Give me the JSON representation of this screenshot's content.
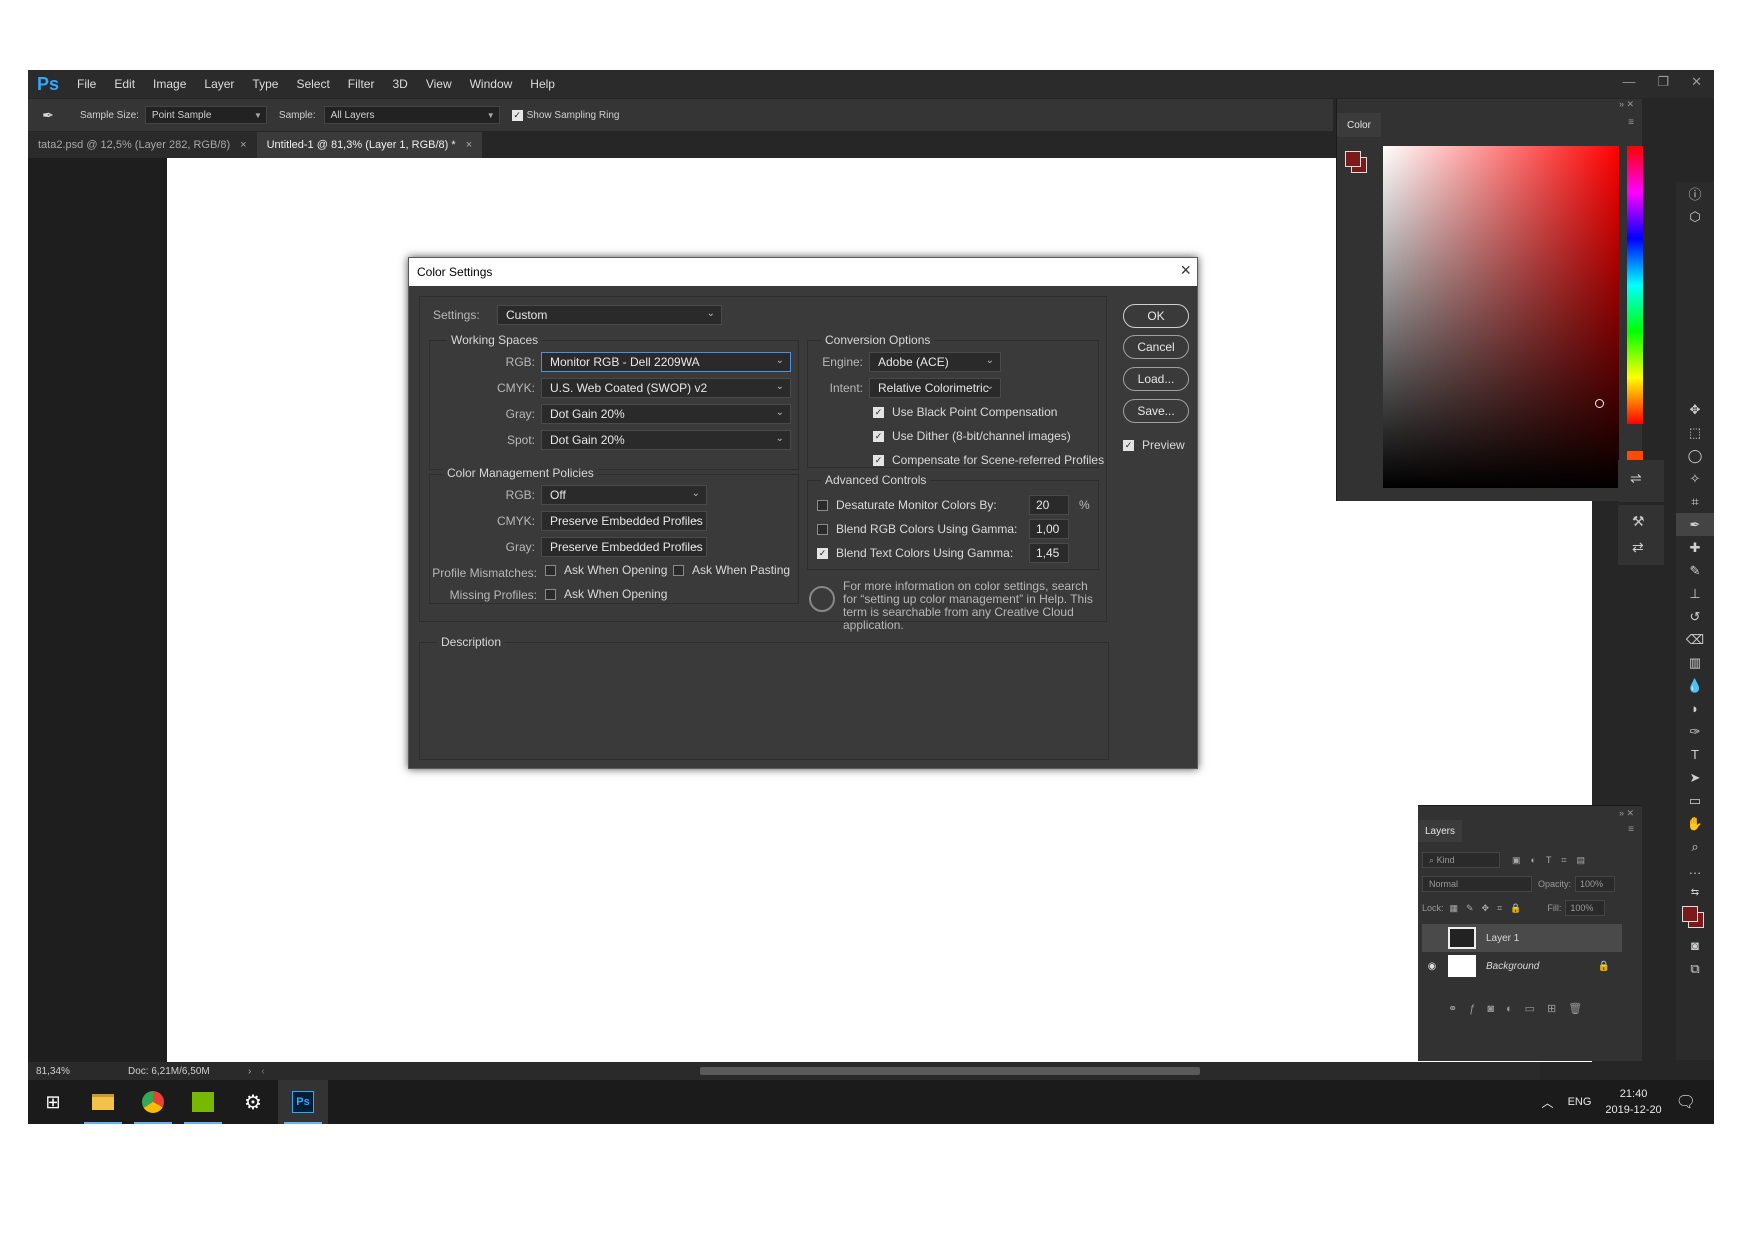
{
  "app": {
    "logo": "Ps",
    "menu": [
      "File",
      "Edit",
      "Image",
      "Layer",
      "Type",
      "Select",
      "Filter",
      "3D",
      "View",
      "Window",
      "Help"
    ],
    "window_controls": [
      "—",
      "❐",
      "✕"
    ]
  },
  "options_bar": {
    "sample_size_label": "Sample Size:",
    "sample_size_value": "Point Sample",
    "sample_label": "Sample:",
    "sample_value": "All Layers",
    "show_sampling_ring_label": "Show Sampling Ring",
    "show_sampling_ring_checked": true
  },
  "tabs": [
    {
      "label": "tata2.psd @ 12,5% (Layer 282, RGB/8)",
      "active": false
    },
    {
      "label": "Untitled-1 @ 81,3% (Layer 1, RGB/8) *",
      "active": true
    }
  ],
  "status_bar": {
    "zoom": "81,34%",
    "doc": "Doc: 6,21M/6,50M"
  },
  "color_panel": {
    "tab": "Color",
    "foreground": "#7a1a1a"
  },
  "layers_panel": {
    "tab": "Layers",
    "filter_placeholder": "Kind",
    "blend_mode": "Normal",
    "opacity_label": "Opacity:",
    "opacity_value": "100%",
    "lock_label": "Lock:",
    "fill_label": "Fill:",
    "fill_value": "100%",
    "layers": [
      {
        "name": "Layer 1",
        "visible": false,
        "selected": true
      },
      {
        "name": "Background",
        "visible": true,
        "locked": true
      }
    ]
  },
  "dialog": {
    "title": "Color Settings",
    "settings_label": "Settings:",
    "settings_value": "Custom",
    "working_spaces": {
      "title": "Working Spaces",
      "rgb_label": "RGB:",
      "rgb_value": "Monitor RGB - Dell 2209WA",
      "cmyk_label": "CMYK:",
      "cmyk_value": "U.S. Web Coated (SWOP) v2",
      "gray_label": "Gray:",
      "gray_value": "Dot Gain 20%",
      "spot_label": "Spot:",
      "spot_value": "Dot Gain 20%"
    },
    "policies": {
      "title": "Color Management Policies",
      "rgb_label": "RGB:",
      "rgb_value": "Off",
      "cmyk_label": "CMYK:",
      "cmyk_value": "Preserve Embedded Profiles",
      "gray_label": "Gray:",
      "gray_value": "Preserve Embedded Profiles",
      "mismatch_label": "Profile Mismatches:",
      "ask_opening": "Ask When Opening",
      "ask_pasting": "Ask When Pasting",
      "missing_label": "Missing Profiles:",
      "missing_ask_opening": "Ask When Opening"
    },
    "conversion": {
      "title": "Conversion Options",
      "engine_label": "Engine:",
      "engine_value": "Adobe (ACE)",
      "intent_label": "Intent:",
      "intent_value": "Relative Colorimetric",
      "black_point": "Use Black Point Compensation",
      "dither": "Use Dither (8-bit/channel images)",
      "scene_referred": "Compensate for Scene-referred Profiles"
    },
    "advanced": {
      "title": "Advanced Controls",
      "desaturate_label": "Desaturate Monitor Colors By:",
      "desaturate_value": "20",
      "desaturate_unit": "%",
      "blend_rgb_label": "Blend RGB Colors Using Gamma:",
      "blend_rgb_value": "1,00",
      "blend_text_label": "Blend Text Colors Using Gamma:",
      "blend_text_value": "1,45"
    },
    "info_text": "For more information on color settings, search for “setting up color management” in Help. This term is searchable from any Creative Cloud application.",
    "description_title": "Description",
    "buttons": {
      "ok": "OK",
      "cancel": "Cancel",
      "load": "Load...",
      "save": "Save...",
      "preview": "Preview"
    }
  },
  "taskbar": {
    "lang": "ENG",
    "time": "21:40",
    "date": "2019-12-20"
  }
}
